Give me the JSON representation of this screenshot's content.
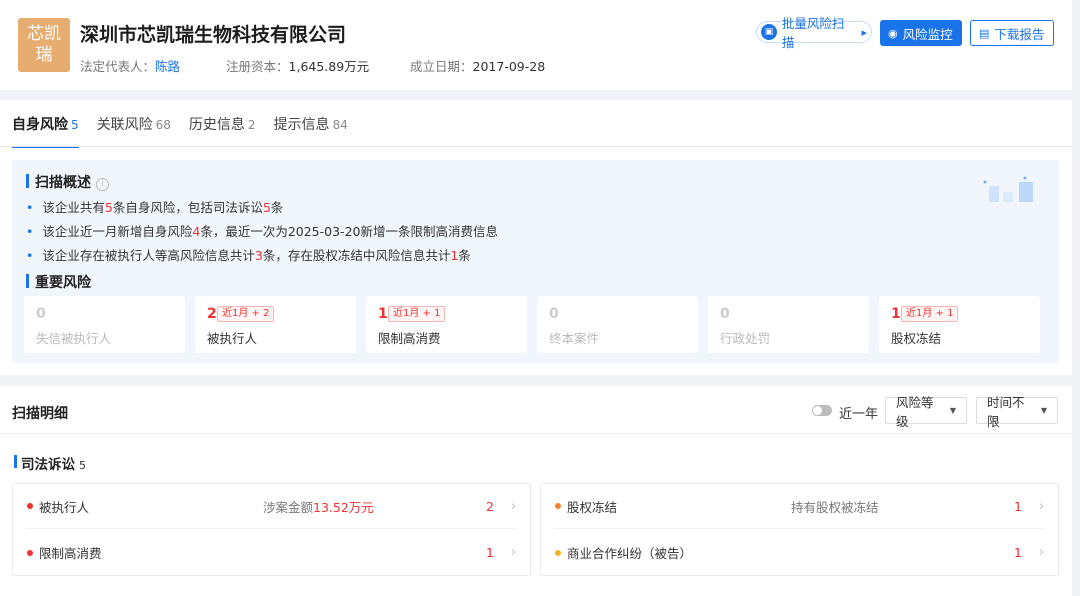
{
  "header": {
    "logo_line1": "芯凯",
    "logo_line2": "瑞",
    "company_name": "深圳市芯凯瑞生物科技有限公司",
    "legal_rep_label": "法定代表人：",
    "legal_rep": "陈路",
    "capital_label": "注册资本：",
    "capital": "1,645.89万元",
    "date_label": "成立日期：",
    "date": "2017-09-28",
    "scan_btn": "批量风险扫描",
    "monitor_btn": "风险监控",
    "download_btn": "下载报告"
  },
  "tabs": [
    {
      "label": "自身风险",
      "count": "5",
      "active": true
    },
    {
      "label": "关联风险",
      "count": "68"
    },
    {
      "label": "历史信息",
      "count": "2"
    },
    {
      "label": "提示信息",
      "count": "84"
    }
  ],
  "overview": {
    "title": "扫描概述",
    "bullet1": {
      "a": "该企业共有",
      "n1": "5",
      "b": "条自身风险，包括司法诉讼",
      "n2": "5",
      "c": "条"
    },
    "bullet2": {
      "a": "该企业近一月新增自身风险",
      "n1": "4",
      "b": "条，最近一次为2025-03-20新增一条限制高消费信息"
    },
    "bullet3": {
      "a": "该企业存在被执行人等高风险信息共计",
      "n1": "3",
      "b": "条，存在股权冻结中风险信息共计",
      "n2": "1",
      "c": "条"
    },
    "major_title": "重要风险",
    "risks": [
      {
        "num": "0",
        "label": "失信被执行人",
        "badge": ""
      },
      {
        "num": "2",
        "label": "被执行人",
        "badge": "近1月 + 2"
      },
      {
        "num": "1",
        "label": "限制高消费",
        "badge": "近1月 + 1"
      },
      {
        "num": "0",
        "label": "终本案件",
        "badge": ""
      },
      {
        "num": "0",
        "label": "行政处罚",
        "badge": ""
      },
      {
        "num": "1",
        "label": "股权冻结",
        "badge": "近1月 + 1"
      }
    ]
  },
  "detail": {
    "title": "扫描明细",
    "toggle_label": "近一年",
    "dropdown_level": "风险等级",
    "dropdown_time": "时间不限",
    "section_title": "司法诉讼",
    "section_count": "5",
    "left_rows": [
      {
        "label": "被执行人",
        "desc_a": "涉案金额",
        "desc_b": "13.52万元",
        "count": "2"
      },
      {
        "label": "限制高消费",
        "count": "1"
      }
    ],
    "right_rows": [
      {
        "label": "股权冻结",
        "desc": "持有股权被冻结",
        "count": "1"
      },
      {
        "label": "商业合作纠纷（被告）",
        "count": "1"
      }
    ]
  },
  "colors": {
    "accent": "#1a73e8",
    "high": "#e33333",
    "medium": "#f07f2d",
    "low": "#f0b429",
    "logo": "#e7ad70"
  }
}
